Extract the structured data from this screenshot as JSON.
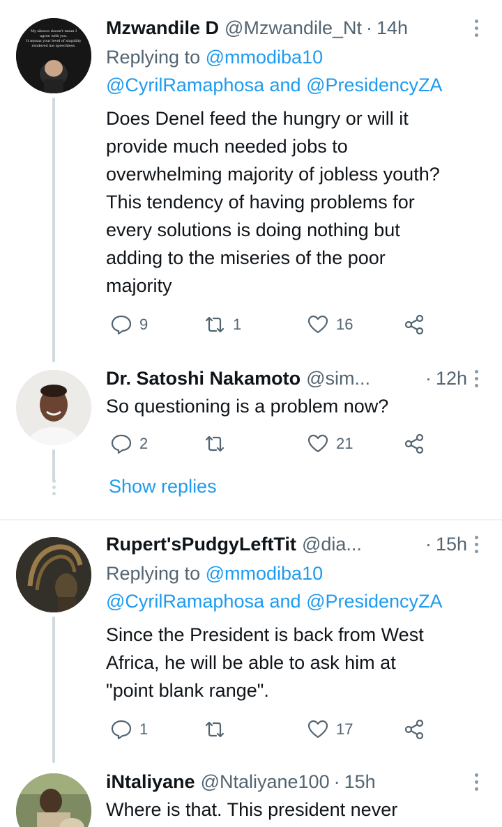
{
  "tweets": [
    {
      "name": "Mzwandile D",
      "handle": "@Mzwandile_Nt",
      "time": "14h",
      "replying_prefix": "Replying to",
      "replying_line1": "@mmodiba10",
      "replying_line2a": "@CyrilRamaphosa",
      "replying_and": "and",
      "replying_line2b": "@PresidencyZA",
      "text_lines": [
        "Does Denel feed the hungry or will it",
        "provide much needed jobs to",
        "overwhelming majority of jobless youth?",
        "This tendency of having problems for",
        "every solutions is doing nothing but",
        "adding to the miseries of the poor",
        "majority"
      ],
      "replies": "9",
      "retweets": "1",
      "likes": "16",
      "avatar_text": [
        "My silence doesn't mean I",
        "agree with you.",
        "It means your level of stupidity",
        "rendered me speechless."
      ]
    },
    {
      "name": "Dr. Satoshi Nakamoto",
      "handle": "@sim...",
      "time": "12h",
      "text_lines": [
        "So questioning is a problem now?"
      ],
      "replies": "2",
      "retweets": "",
      "likes": "21"
    },
    {
      "name": "Rupert'sPudgyLeftTit",
      "handle": "@dia...",
      "time": "15h",
      "replying_prefix": "Replying to",
      "replying_line1": "@mmodiba10",
      "replying_line2a": "@CyrilRamaphosa",
      "replying_and": "and",
      "replying_line2b": "@PresidencyZA",
      "text_lines": [
        "Since the President is back from West",
        "Africa, he will be able to ask him at",
        "\"point blank range\"."
      ],
      "replies": "1",
      "retweets": "",
      "likes": "17"
    },
    {
      "name": "iNtaliyane",
      "handle": "@Ntaliyane100",
      "time": "15h",
      "text_lines": [
        "Where is that. This president never"
      ]
    }
  ],
  "show_replies": "Show replies",
  "separator": "·",
  "colors": {
    "accent": "#1d9bf0",
    "secondary_text": "#536471",
    "primary_text": "#0f1419",
    "divider": "#eff3f4"
  },
  "icons": [
    "reply-icon",
    "retweet-icon",
    "like-icon",
    "share-icon",
    "more-icon"
  ]
}
